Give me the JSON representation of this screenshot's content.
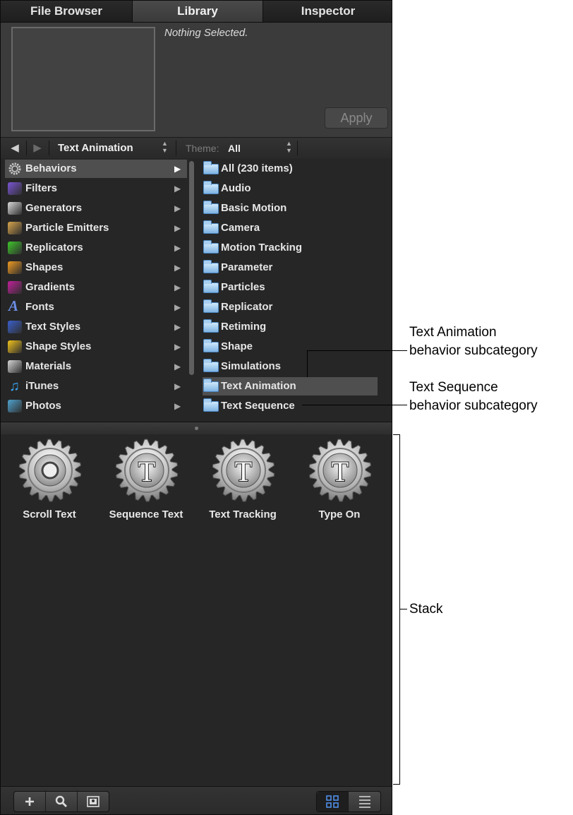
{
  "tabs": [
    "File Browser",
    "Library",
    "Inspector"
  ],
  "preview": {
    "status": "Nothing Selected.",
    "apply_label": "Apply"
  },
  "nav": {
    "category": "Text Animation",
    "theme_label": "Theme:",
    "theme_value": "All"
  },
  "categories": [
    {
      "label": "Behaviors",
      "icon": "gear-icon",
      "color": "#c8c8c8"
    },
    {
      "label": "Filters",
      "icon": "filters-icon",
      "color": "#7b55d6"
    },
    {
      "label": "Generators",
      "icon": "generators-icon",
      "color": "#d9d9d9"
    },
    {
      "label": "Particle Emitters",
      "icon": "particle-emitter-icon",
      "color": "#d8a44b"
    },
    {
      "label": "Replicators",
      "icon": "replicator-icon",
      "color": "#3ec62a"
    },
    {
      "label": "Shapes",
      "icon": "shapes-icon",
      "color": "#f09a21"
    },
    {
      "label": "Gradients",
      "icon": "gradient-icon",
      "color": "#c0209a"
    },
    {
      "label": "Fonts",
      "icon": "font-icon",
      "color": "#6c8fe6"
    },
    {
      "label": "Text Styles",
      "icon": "text-style-icon",
      "color": "#3a5fcc"
    },
    {
      "label": "Shape Styles",
      "icon": "shape-style-icon",
      "color": "#f2c31c"
    },
    {
      "label": "Materials",
      "icon": "materials-icon",
      "color": "#d6d6d6"
    },
    {
      "label": "iTunes",
      "icon": "music-note-icon",
      "color": "#39a7f5"
    },
    {
      "label": "Photos",
      "icon": "photos-icon",
      "color": "#4fa3cf"
    }
  ],
  "subcategories": [
    "All (230 items)",
    "Audio",
    "Basic Motion",
    "Camera",
    "Motion Tracking",
    "Parameter",
    "Particles",
    "Replicator",
    "Retiming",
    "Shape",
    "Simulations",
    "Text Animation",
    "Text Sequence"
  ],
  "stack_items": [
    {
      "label": "Scroll Text",
      "glyph": ""
    },
    {
      "label": "Sequence Text",
      "glyph": "T"
    },
    {
      "label": "Text Tracking",
      "glyph": "T"
    },
    {
      "label": "Type On",
      "glyph": "T"
    }
  ],
  "callouts": {
    "text_animation": [
      "Text Animation",
      "behavior subcategory"
    ],
    "text_sequence": [
      "Text Sequence",
      "behavior subcategory"
    ],
    "stack": "Stack"
  },
  "colors": {
    "selection": "#4f4f4f",
    "active_view_icon": "#4f8ee8"
  }
}
